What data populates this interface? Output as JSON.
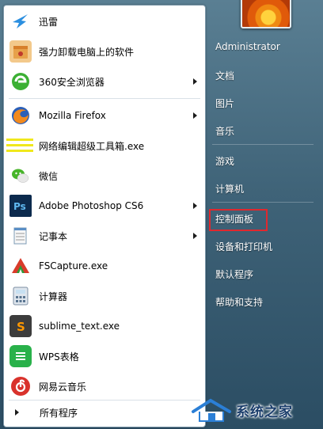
{
  "left_menu": {
    "items": [
      {
        "label": "迅雷",
        "icon": "thunder-bird-icon",
        "has_submenu": false
      },
      {
        "label": "强力卸载电脑上的软件",
        "icon": "uninstall-box-icon",
        "has_submenu": false
      },
      {
        "label": "360安全浏览器",
        "icon": "browser-360-icon",
        "has_submenu": true
      },
      {
        "label": "Mozilla Firefox",
        "icon": "firefox-icon",
        "has_submenu": true
      },
      {
        "label": "网络编辑超级工具箱.exe",
        "icon": "toolbox-icon",
        "has_submenu": false
      },
      {
        "label": "微信",
        "icon": "wechat-icon",
        "has_submenu": false
      },
      {
        "label": "Adobe Photoshop CS6",
        "icon": "photoshop-icon",
        "has_submenu": true
      },
      {
        "label": "记事本",
        "icon": "notepad-icon",
        "has_submenu": true
      },
      {
        "label": "FSCapture.exe",
        "icon": "fscapture-icon",
        "has_submenu": false
      },
      {
        "label": "计算器",
        "icon": "calculator-icon",
        "has_submenu": false
      },
      {
        "label": "sublime_text.exe",
        "icon": "sublime-icon",
        "has_submenu": false
      },
      {
        "label": "WPS表格",
        "icon": "wps-sheet-icon",
        "has_submenu": false
      },
      {
        "label": "网易云音乐",
        "icon": "netease-music-icon",
        "has_submenu": false
      }
    ],
    "all_programs": "所有程序"
  },
  "right_menu": {
    "user": "Administrator",
    "items": [
      "文档",
      "图片",
      "音乐",
      "游戏",
      "计算机",
      "控制面板",
      "设备和打印机",
      "默认程序",
      "帮助和支持"
    ],
    "highlighted": "控制面板"
  },
  "watermark": {
    "text": "系统之家"
  },
  "colors": {
    "highlight_box": "#e0282e",
    "menu_right_bg": "#3f6378"
  }
}
